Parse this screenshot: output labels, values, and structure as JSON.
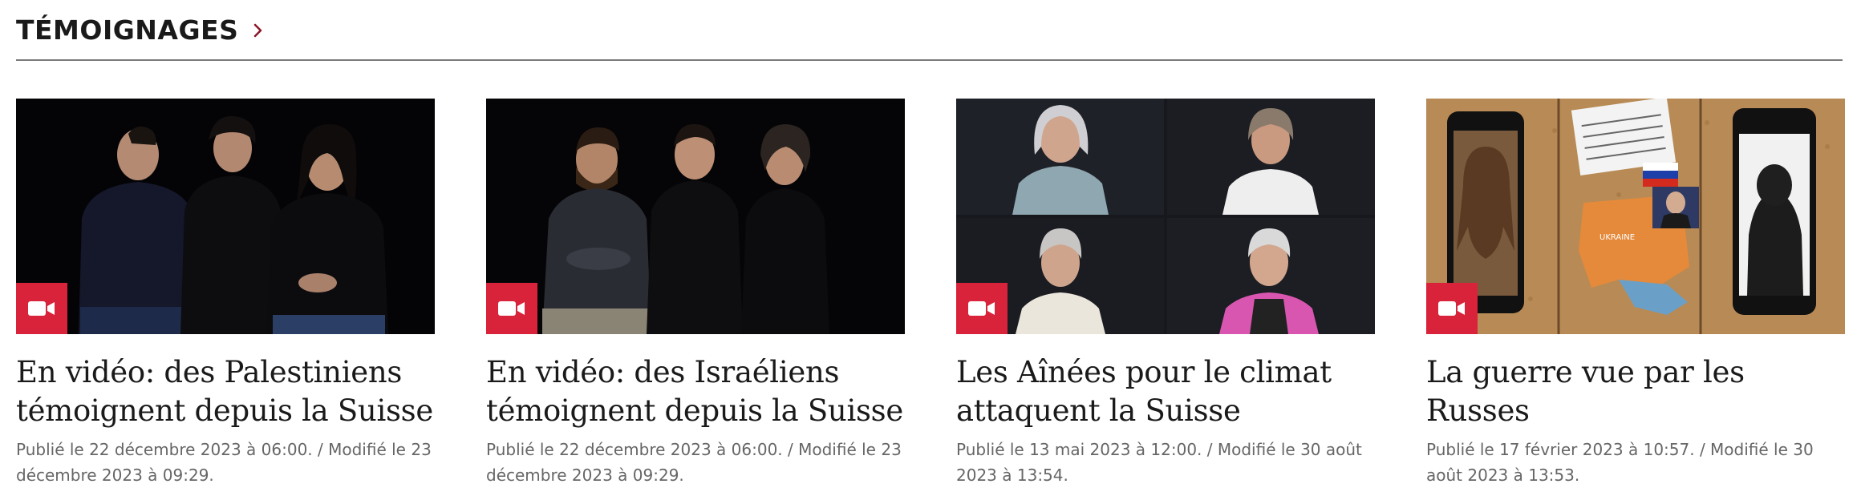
{
  "section": {
    "title": "TÉMOIGNAGES",
    "chevron_icon": "chevron-right-icon",
    "accent_color": "#8b1a2b"
  },
  "badge": {
    "icon": "video-camera-icon",
    "color": "#d8233a"
  },
  "cards": [
    {
      "title": "En vidéo: des Palestiniens témoignent depuis la Suisse",
      "meta": "Publié le 22 décembre 2023 à 06:00. / Modifié le 23 décembre 2023 à 09:29."
    },
    {
      "title": "En vidéo: des Israéliens témoignent depuis la Suisse",
      "meta": "Publié le 22 décembre 2023 à 06:00. / Modifié le 23 décembre 2023 à 09:29."
    },
    {
      "title": "Les Aînées pour le climat attaquent la Suisse",
      "meta": "Publié le 13 mai 2023 à 12:00. / Modifié le 30 août 2023 à 13:54."
    },
    {
      "title": "La guerre vue par les Russes",
      "meta": "Publié le 17 février 2023 à 10:57. / Modifié le 30 août 2023 à 13:53."
    }
  ],
  "map_text": {
    "country": "UKRAINE"
  }
}
